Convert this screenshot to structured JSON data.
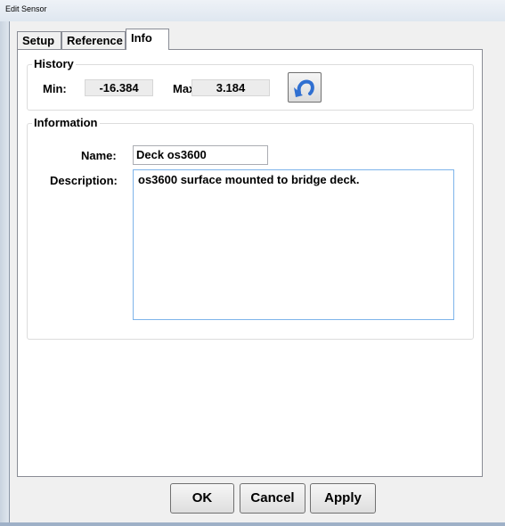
{
  "window": {
    "title": "Edit Sensor"
  },
  "tabs": [
    {
      "label": "Setup"
    },
    {
      "label": "Reference"
    },
    {
      "label": "Info"
    }
  ],
  "active_tab": "Info",
  "history": {
    "group_label": "History",
    "min_label": "Min:",
    "min_value": "-16.384",
    "max_label": "Max:",
    "max_value": "3.184",
    "reset_icon": "reset-arrow-icon"
  },
  "information": {
    "group_label": "Information",
    "name_label": "Name:",
    "name_value": "Deck os3600",
    "description_label": "Description:",
    "description_value": "os3600 surface mounted to bridge deck."
  },
  "buttons": {
    "ok": "OK",
    "cancel": "Cancel",
    "apply": "Apply"
  },
  "colors": {
    "reset_arrow": "#2f6fd1",
    "description_border": "#7eb4ea"
  }
}
